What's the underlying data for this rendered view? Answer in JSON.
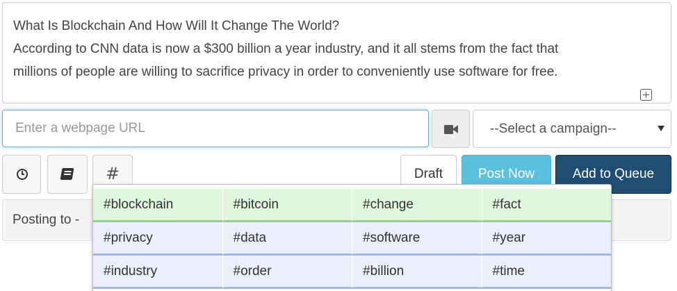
{
  "composer": {
    "lines": [
      "What Is Blockchain And How Will It Change The World?",
      "According to CNN data is now a $300 billion a year industry, and it all stems from the fact that",
      "millions of people are willing to sacrifice privacy in order to conveniently use software for free."
    ],
    "expand_icon": "plus-square-icon"
  },
  "url_input": {
    "placeholder": "Enter a webpage URL",
    "value": ""
  },
  "video_button": {
    "icon": "video-camera-icon"
  },
  "campaign_select": {
    "selected": "--Select a campaign--"
  },
  "toolbar": {
    "schedule_icon": "clock-icon",
    "library_icon": "book-icon",
    "hashtag_icon": "#"
  },
  "actions": {
    "draft": "Draft",
    "post_now": "Post Now",
    "add_to_queue": "Add to Queue"
  },
  "posting": {
    "label": "Posting to -"
  },
  "hashtags": {
    "rows": [
      [
        "#blockchain",
        "#bitcoin",
        "#change",
        "#fact"
      ],
      [
        "#privacy",
        "#data",
        "#software",
        "#year"
      ],
      [
        "#industry",
        "#order",
        "#billion",
        "#time"
      ]
    ]
  },
  "colors": {
    "post_now": "#5bc0de",
    "add_to_queue": "#204d74",
    "tag_green": "#dff7dc",
    "tag_blue": "#eceefc",
    "focus_border": "#66afe9"
  }
}
